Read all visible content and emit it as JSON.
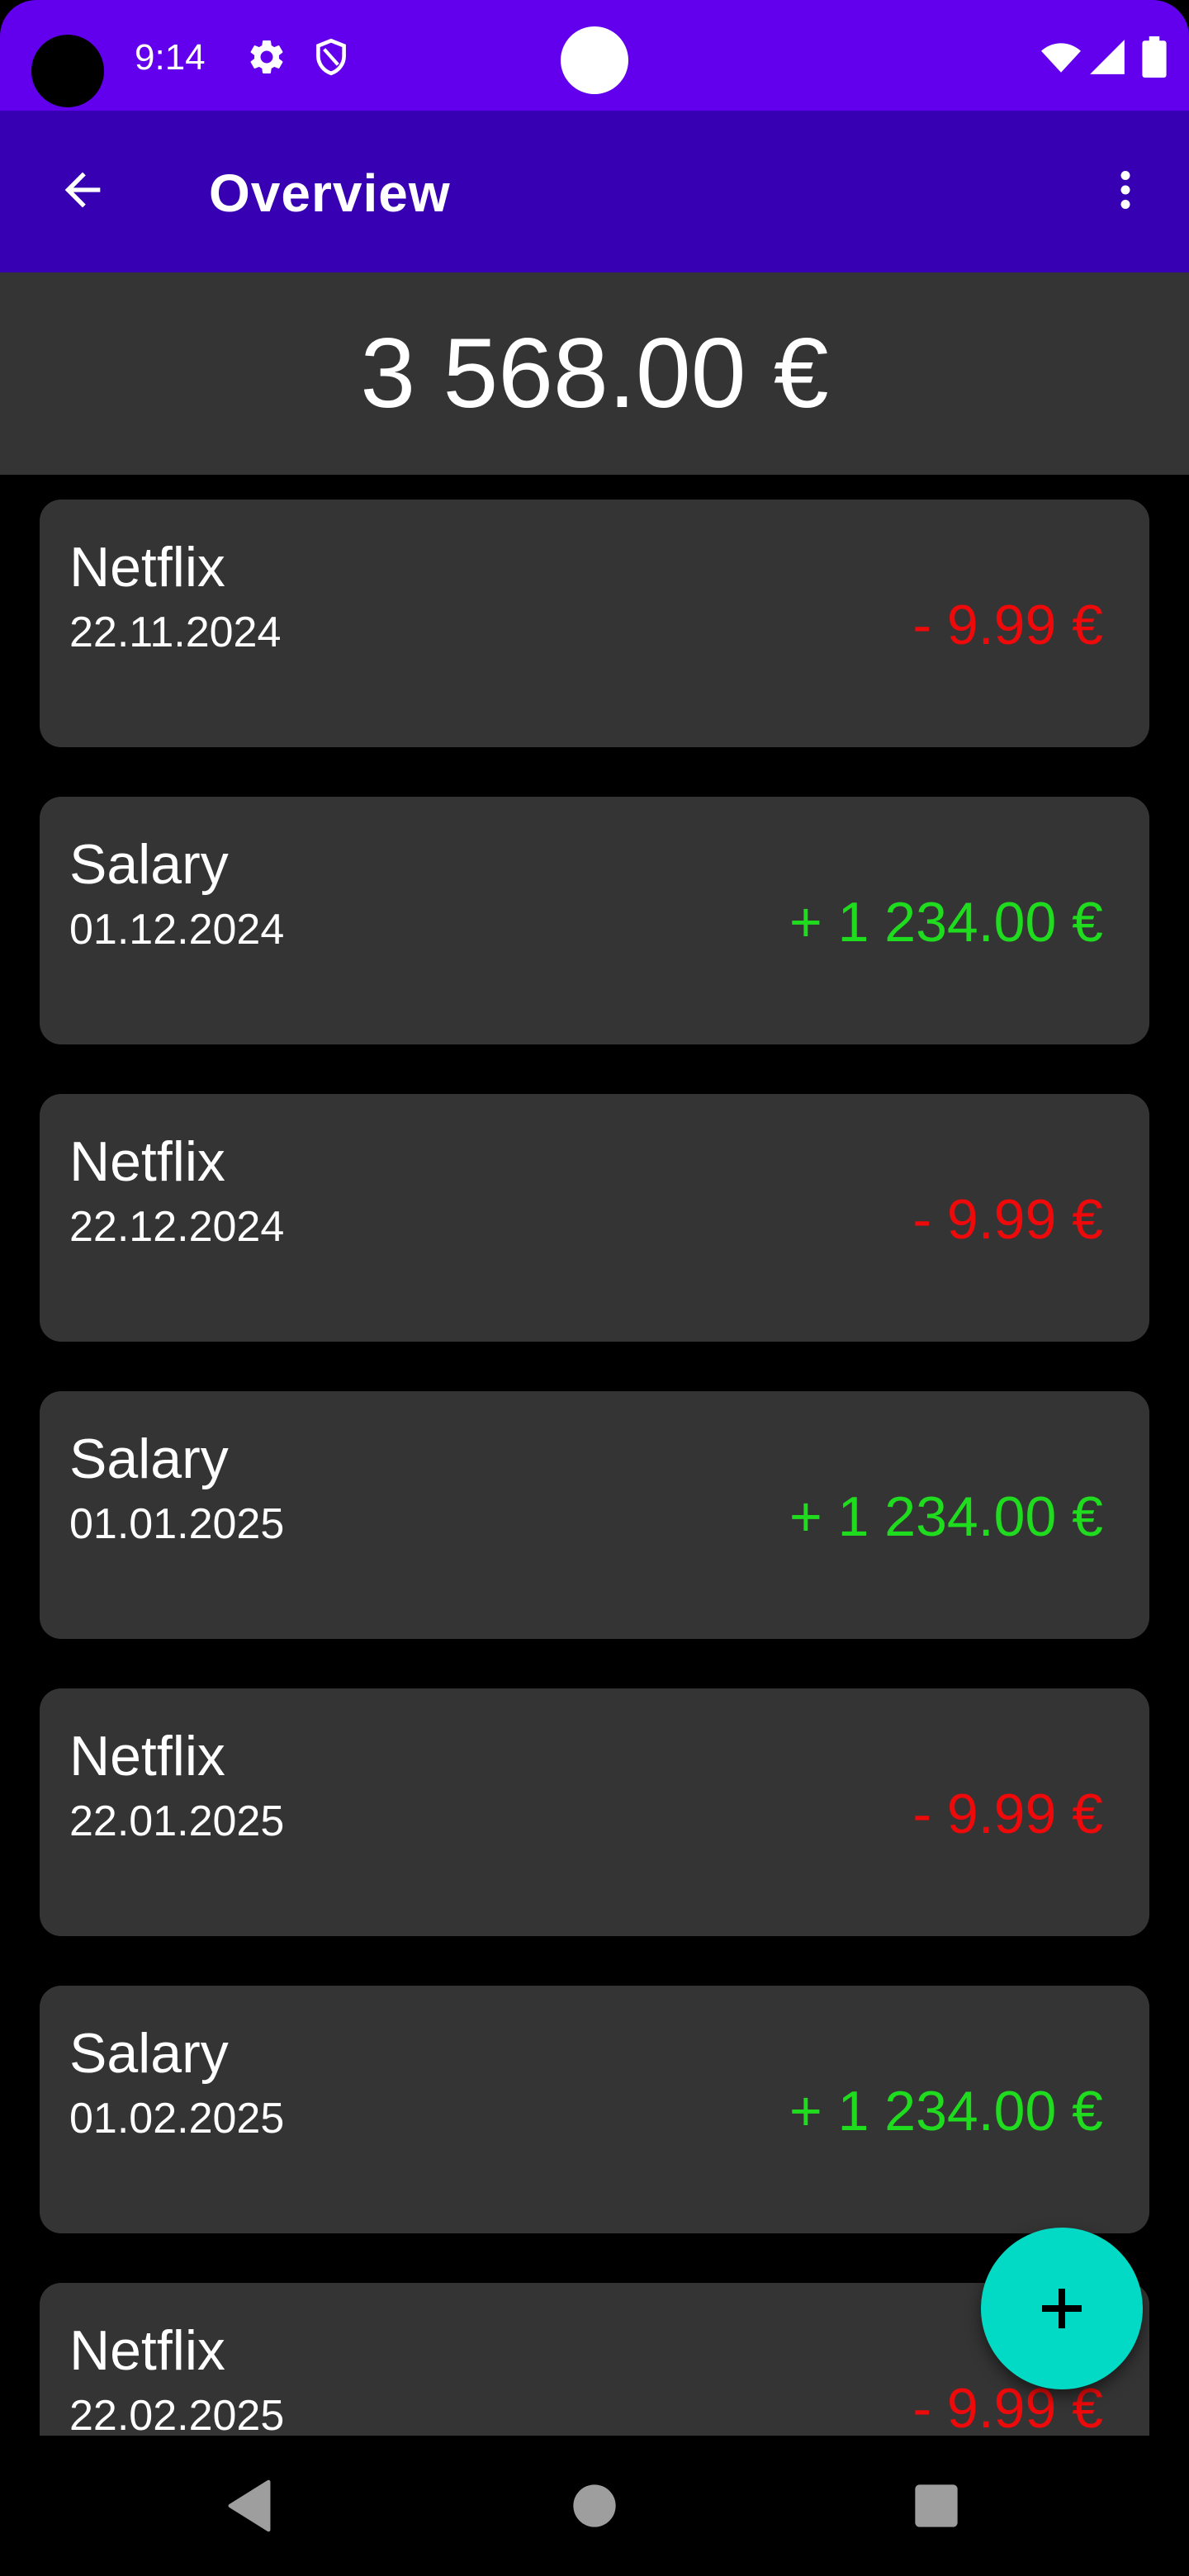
{
  "status_bar": {
    "time": "9:14",
    "icons": [
      "gear-icon",
      "shield-icon",
      "wifi-icon",
      "signal-icon",
      "battery-icon"
    ],
    "background": "#6200ee"
  },
  "app_bar": {
    "title": "Overview",
    "back_icon": "arrow-back-icon",
    "menu_icon": "more-vert-icon",
    "background": "#3700b3"
  },
  "balance": {
    "value": "3 568.00 €"
  },
  "transactions": [
    {
      "name": "Netflix",
      "date": "22.11.2024",
      "amount": "- 9.99 €",
      "type": "negative"
    },
    {
      "name": "Salary",
      "date": "01.12.2024",
      "amount": "+ 1 234.00 €",
      "type": "positive"
    },
    {
      "name": "Netflix",
      "date": "22.12.2024",
      "amount": "- 9.99 €",
      "type": "negative"
    },
    {
      "name": "Salary",
      "date": "01.01.2025",
      "amount": "+ 1 234.00 €",
      "type": "positive"
    },
    {
      "name": "Netflix",
      "date": "22.01.2025",
      "amount": "- 9.99 €",
      "type": "negative"
    },
    {
      "name": "Salary",
      "date": "01.02.2025",
      "amount": "+ 1 234.00 €",
      "type": "positive"
    },
    {
      "name": "Netflix",
      "date": "22.02.2025",
      "amount": "- 9.99 €",
      "type": "negative"
    }
  ],
  "colors": {
    "negative": "#ee0a0a",
    "positive": "#1fdc1f",
    "card": "#343434",
    "fab": "#03dac5"
  },
  "fab": {
    "icon": "plus-icon"
  },
  "nav_bar": {
    "icons": [
      "back-triangle-icon",
      "home-circle-icon",
      "recents-square-icon"
    ]
  }
}
